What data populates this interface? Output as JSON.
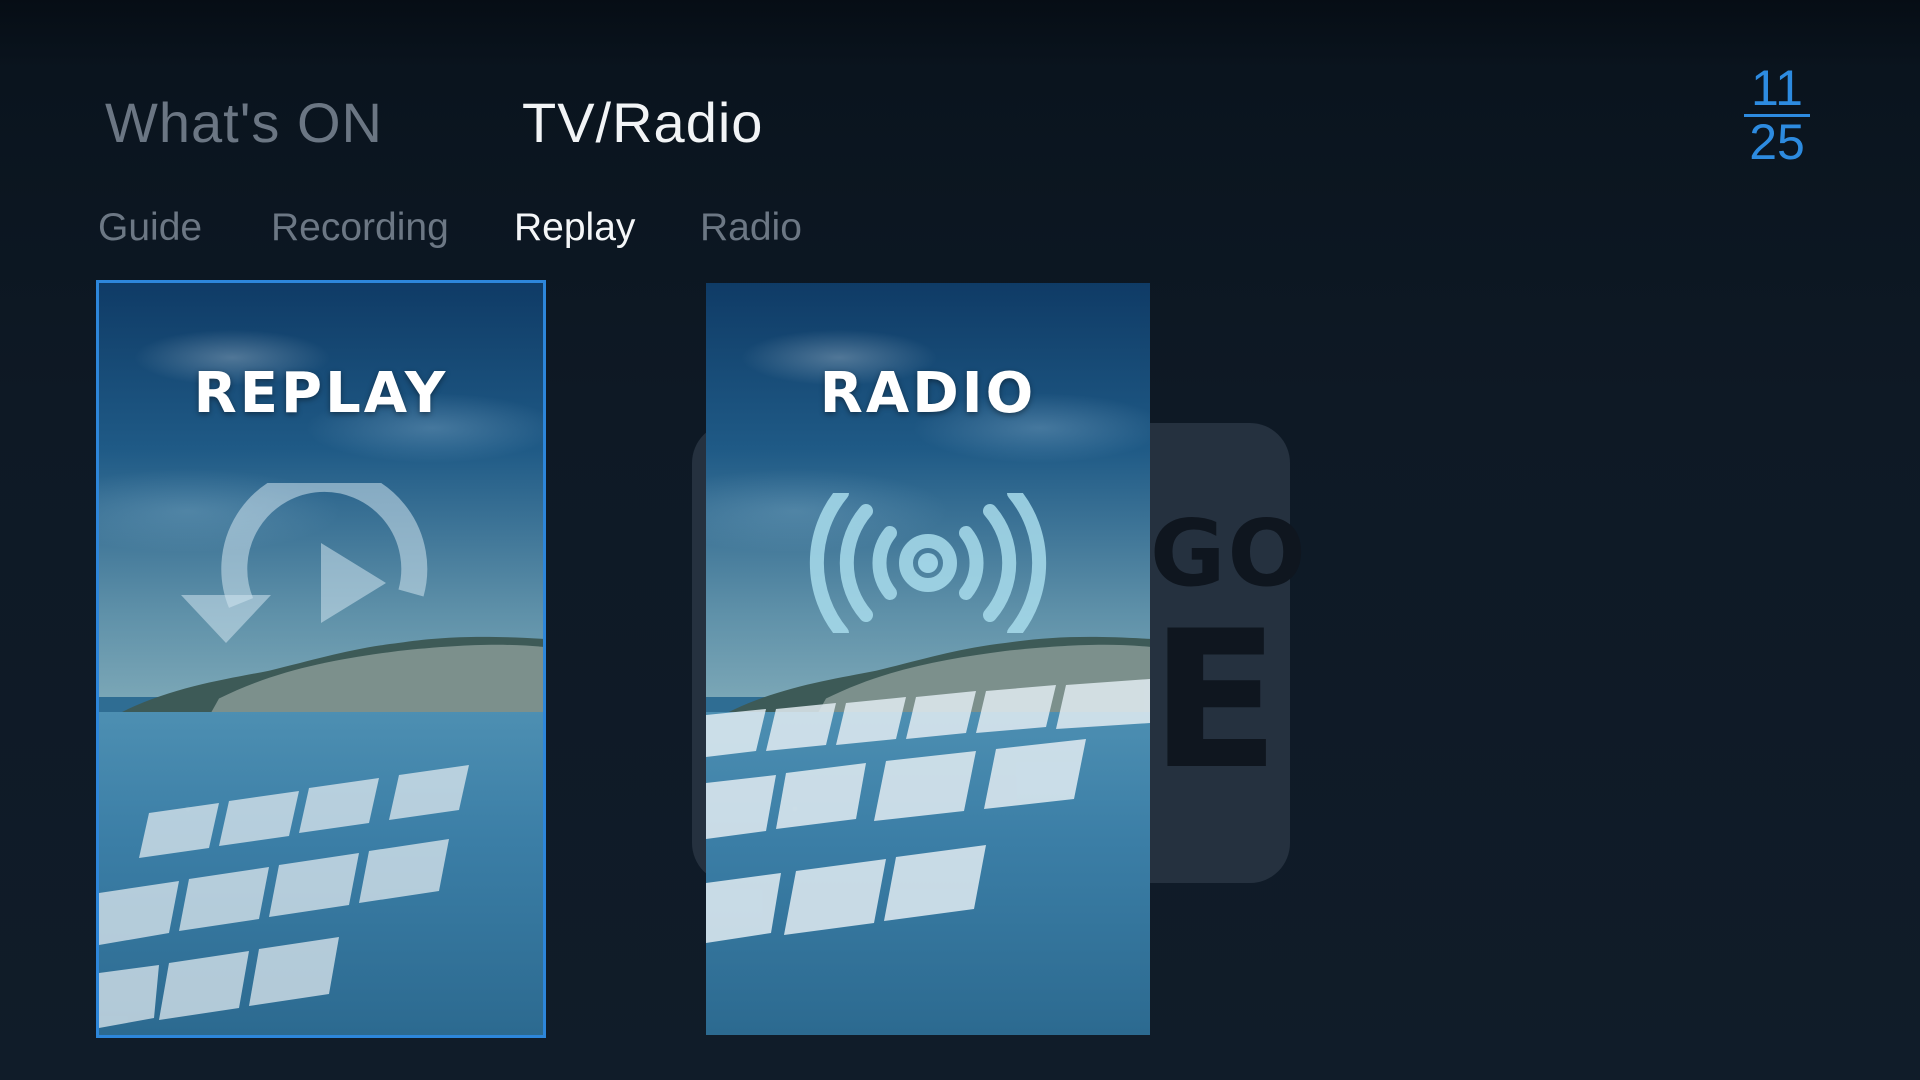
{
  "header": {
    "tabs": [
      {
        "label": "What's ON",
        "active": false
      },
      {
        "label": "TV/Radio",
        "active": true
      }
    ],
    "clock": {
      "hours": "11",
      "minutes": "25"
    }
  },
  "subnav": {
    "tabs": [
      {
        "label": "Guide",
        "active": false
      },
      {
        "label": "Recording",
        "active": false
      },
      {
        "label": "Replay",
        "active": true
      },
      {
        "label": "Radio",
        "active": false
      }
    ]
  },
  "cards": [
    {
      "title": "REPLAY",
      "icon": "replay-icon",
      "focused": true
    },
    {
      "title": "RADIO",
      "icon": "radio-broadcast-icon",
      "focused": false
    }
  ],
  "background_logo": {
    "letters_top": "GO",
    "letters_bottom": "E"
  },
  "colors": {
    "accent": "#2d8be0",
    "background": "#0e1925",
    "inactive_text": "#6b7683",
    "active_text": "#f2f4f6"
  }
}
